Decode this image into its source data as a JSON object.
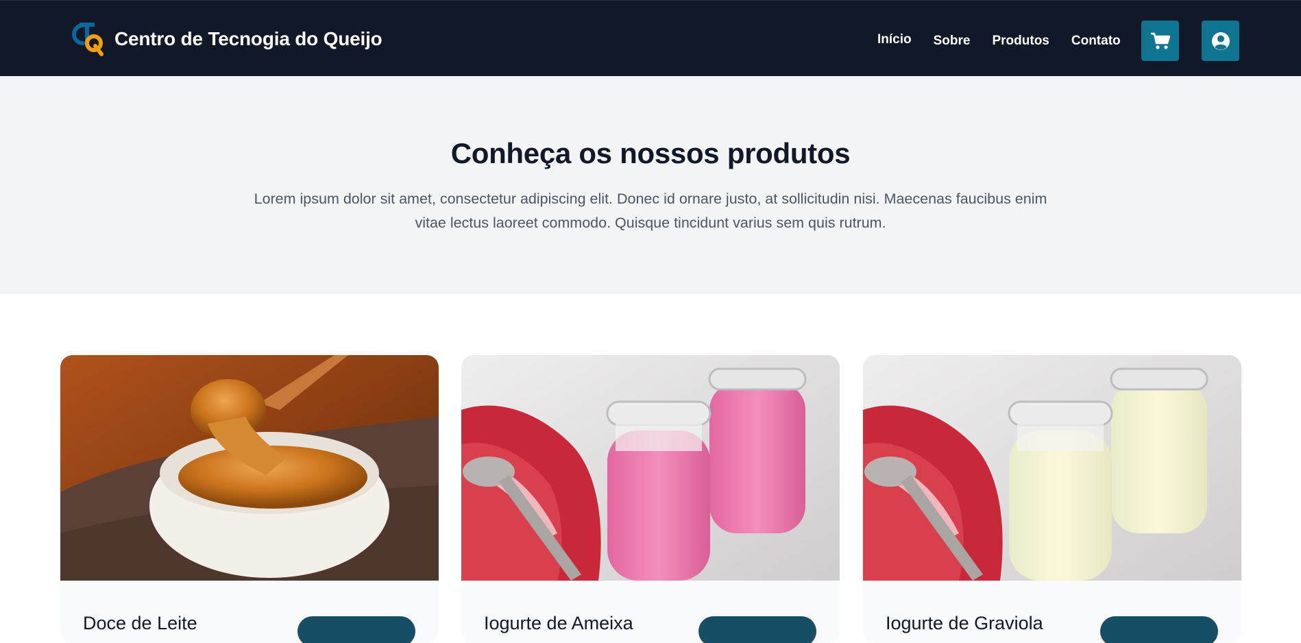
{
  "brand": {
    "logo_letters": "CTQ",
    "name": "Centro de Tecnogia do Queijo"
  },
  "nav": {
    "links": [
      "Início",
      "Sobre",
      "Produtos",
      "Contato"
    ],
    "cart_icon": "cart-icon",
    "user_icon": "user-circle-icon"
  },
  "hero": {
    "title": "Conheça os nossos produtos",
    "text": "Lorem ipsum dolor sit amet, consectetur adipiscing elit. Donec id ornare justo, at sollicitudin nisi. Maecenas faucibus enim vitae lectus laoreet commodo. Quisque tincidunt varius sem quis rutrum."
  },
  "products": [
    {
      "name": "Doce de Leite",
      "image": "dulce-de-leche-bowl-photo"
    },
    {
      "name": "Iogurte de Ameixa",
      "image": "pink-yogurt-jars-photo"
    },
    {
      "name": "Iogurte de Graviola",
      "image": "cream-yogurt-jars-photo"
    }
  ],
  "colors": {
    "navbar_bg": "#111827",
    "accent": "#0e7490",
    "hero_bg": "#f3f4f6",
    "logo_blue": "#0369a1",
    "logo_orange": "#f59e0b"
  }
}
